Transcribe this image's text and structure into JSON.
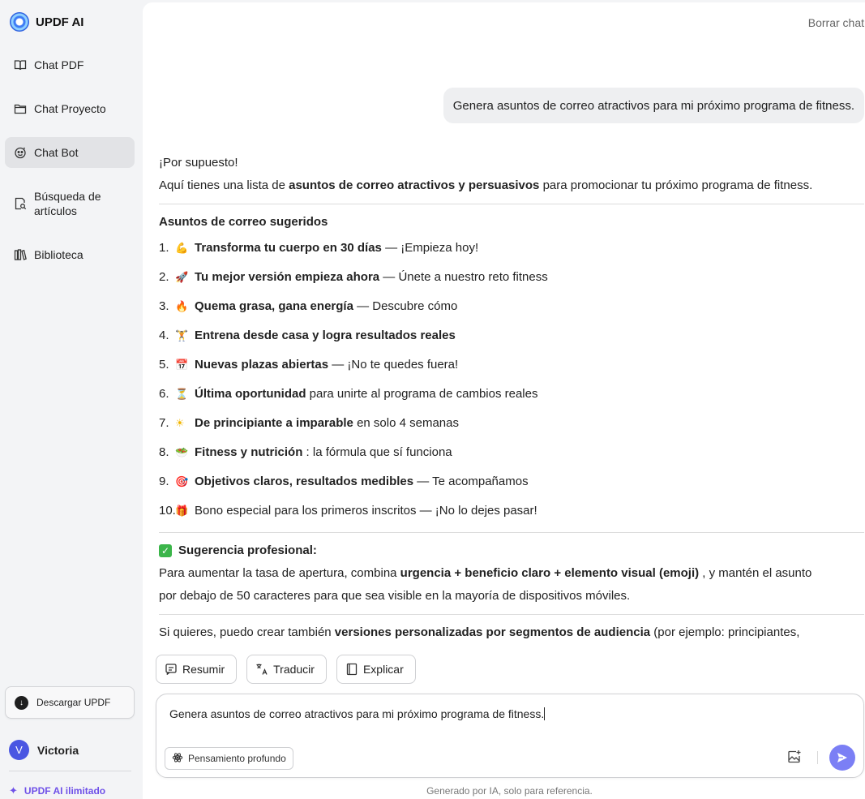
{
  "brand": {
    "name": "UPDF AI"
  },
  "sidebar": {
    "items": [
      {
        "label": "Chat PDF",
        "icon": "book-open-icon"
      },
      {
        "label": "Chat Proyecto",
        "icon": "folder-icon"
      },
      {
        "label": "Chat Bot",
        "icon": "bot-icon",
        "active": true
      },
      {
        "label": "Búsqueda de artículos",
        "icon": "search-document-icon"
      },
      {
        "label": "Biblioteca",
        "icon": "library-icon"
      }
    ],
    "download_label": "Descargar UPDF",
    "user": {
      "initial": "V",
      "name": "Victoria"
    },
    "upgrade_label": "UPDF AI ilimitado"
  },
  "header": {
    "clear_chat": "Borrar chat"
  },
  "conversation": {
    "user_message": "Genera asuntos de correo atractivos para mi próximo programa de fitness.",
    "answer": {
      "greeting": "¡Por supuesto!",
      "intro_before": "Aquí tienes una lista de ",
      "intro_bold": "asuntos de correo atractivos y persuasivos",
      "intro_after": " para promocionar tu próximo programa de fitness.",
      "section_title": "Asuntos de correo sugeridos",
      "items": [
        {
          "num": "1.",
          "emoji": "💪",
          "bold": "Transforma tu cuerpo en 30 días",
          "rest": " — ¡Empieza hoy!"
        },
        {
          "num": "2.",
          "emoji": "🚀",
          "bold": "Tu mejor versión empieza ahora",
          "rest": " — Únete a nuestro reto fitness"
        },
        {
          "num": "3.",
          "emoji": "🔥",
          "bold": "Quema grasa, gana energía",
          "rest": " — Descubre cómo"
        },
        {
          "num": "4.",
          "emoji": "🏋",
          "bold": "Entrena desde casa y logra resultados reales",
          "rest": ""
        },
        {
          "num": "5.",
          "emoji": "📅",
          "bold": "Nuevas plazas abiertas",
          "rest": " — ¡No te quedes fuera!"
        },
        {
          "num": "6.",
          "emoji": "⏳",
          "bold": "Última oportunidad",
          "rest": " para unirte al programa de cambios reales"
        },
        {
          "num": "7.",
          "emoji": "☀",
          "bold": "De principiante a imparable",
          "rest": " en solo 4 semanas"
        },
        {
          "num": "8.",
          "emoji": "🥗",
          "bold": "Fitness y nutrición",
          "rest": " : la fórmula que sí funciona"
        },
        {
          "num": "9.",
          "emoji": "🎯",
          "bold": "Objetivos claros, resultados medibles",
          "rest": " — Te acompañamos"
        },
        {
          "num": "10.",
          "emoji": "🎁",
          "bold": "",
          "rest": "Bono especial para los primeros inscritos — ¡No lo dejes pasar!"
        }
      ],
      "tip_title": "Sugerencia profesional:",
      "tip_before": "Para aumentar la tasa de apertura, combina ",
      "tip_bold": "urgencia + beneficio claro + elemento visual (emoji)",
      "tip_after_line1": " , y mantén el asunto",
      "tip_line2": "por debajo de 50 caracteres para que sea visible en la mayoría de dispositivos móviles.",
      "closing_before": "Si quieres, puedo crear también ",
      "closing_bold": "versiones personalizadas por segmentos de audiencia",
      "closing_after": " (por ejemplo: principiantes,"
    }
  },
  "quick_actions": [
    {
      "label": "Resumir",
      "icon": "summarize-icon"
    },
    {
      "label": "Traducir",
      "icon": "translate-icon"
    },
    {
      "label": "Explicar",
      "icon": "explain-book-icon"
    }
  ],
  "composer": {
    "value": "Genera asuntos de correo atractivos para mi próximo programa de fitness.",
    "deep_think_label": "Pensamiento profundo"
  },
  "footer": {
    "disclaimer": "Generado por IA, solo para referencia."
  },
  "colors": {
    "accent": "#7b7ff5",
    "upgrade": "#6f51e8",
    "avatar": "#4a56e2"
  }
}
